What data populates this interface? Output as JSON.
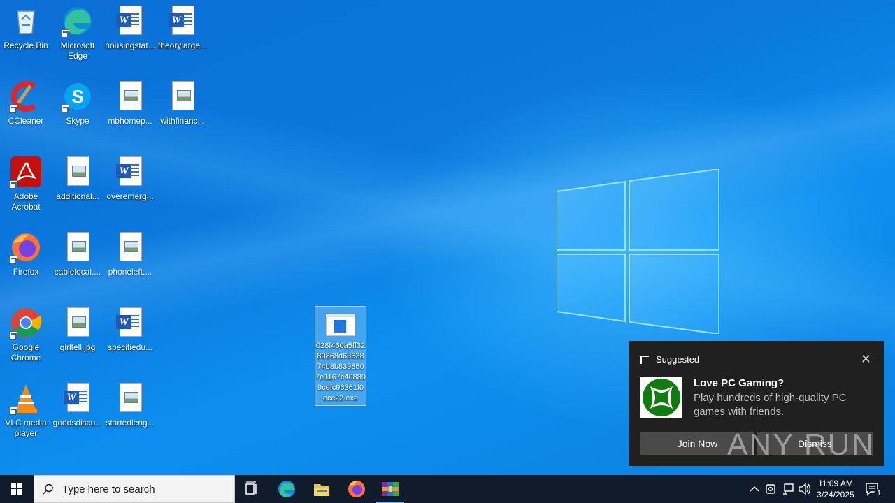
{
  "desktop": {
    "icons": [
      {
        "label": "Recycle Bin",
        "icon": "recycle-bin-icon"
      },
      {
        "label": "Microsoft Edge",
        "icon": "edge-icon"
      },
      {
        "label": "housingstat...",
        "icon": "word-document-icon"
      },
      {
        "label": "theorylarge...",
        "icon": "word-document-icon"
      },
      {
        "label": "CCleaner",
        "icon": "ccleaner-icon"
      },
      {
        "label": "Skype",
        "icon": "skype-icon"
      },
      {
        "label": "mbhomep...",
        "icon": "image-file-icon"
      },
      {
        "label": "withfinanc...",
        "icon": "image-file-icon"
      },
      {
        "label": "Adobe Acrobat",
        "icon": "acrobat-icon"
      },
      {
        "label": "additional...",
        "icon": "image-file-icon"
      },
      {
        "label": "overemerg...",
        "icon": "word-document-icon"
      },
      {
        "label": "Firefox",
        "icon": "firefox-icon"
      },
      {
        "label": "cablelocal....",
        "icon": "image-file-icon"
      },
      {
        "label": "phoneleft....",
        "icon": "image-file-icon"
      },
      {
        "label": "Google Chrome",
        "icon": "chrome-icon"
      },
      {
        "label": "girltell.jpg",
        "icon": "image-file-icon"
      },
      {
        "label": "specifiedu...",
        "icon": "word-document-icon"
      },
      {
        "label": "VLC media player",
        "icon": "vlc-icon"
      },
      {
        "label": "goodsdiscu...",
        "icon": "word-document-icon"
      },
      {
        "label": "startedleng...",
        "icon": "image-file-icon"
      }
    ],
    "selected_file": {
      "label": "028f460a5ff3289868d6363874b3b8398507e1167c408899cefc96361f0ecc22.exe",
      "icon": "executable-icon"
    }
  },
  "toast": {
    "header": "Suggested",
    "title": "Love PC Gaming?",
    "body": "Play hundreds of high-quality PC games with friends.",
    "primary_button": "Join Now",
    "secondary_button": "Dismiss"
  },
  "watermark": "ANY RUN",
  "taskbar": {
    "search_placeholder": "Type here to search",
    "pinned": [
      "task-view-icon",
      "edge-icon",
      "file-explorer-icon",
      "firefox-icon",
      "winrar-icon"
    ],
    "time": "11:09 AM",
    "date": "3/24/2025",
    "notification_count": "1"
  },
  "colors": {
    "desktop_blue": "#0a78dc",
    "taskbar": "#101c2c",
    "toast_bg": "#202020"
  }
}
